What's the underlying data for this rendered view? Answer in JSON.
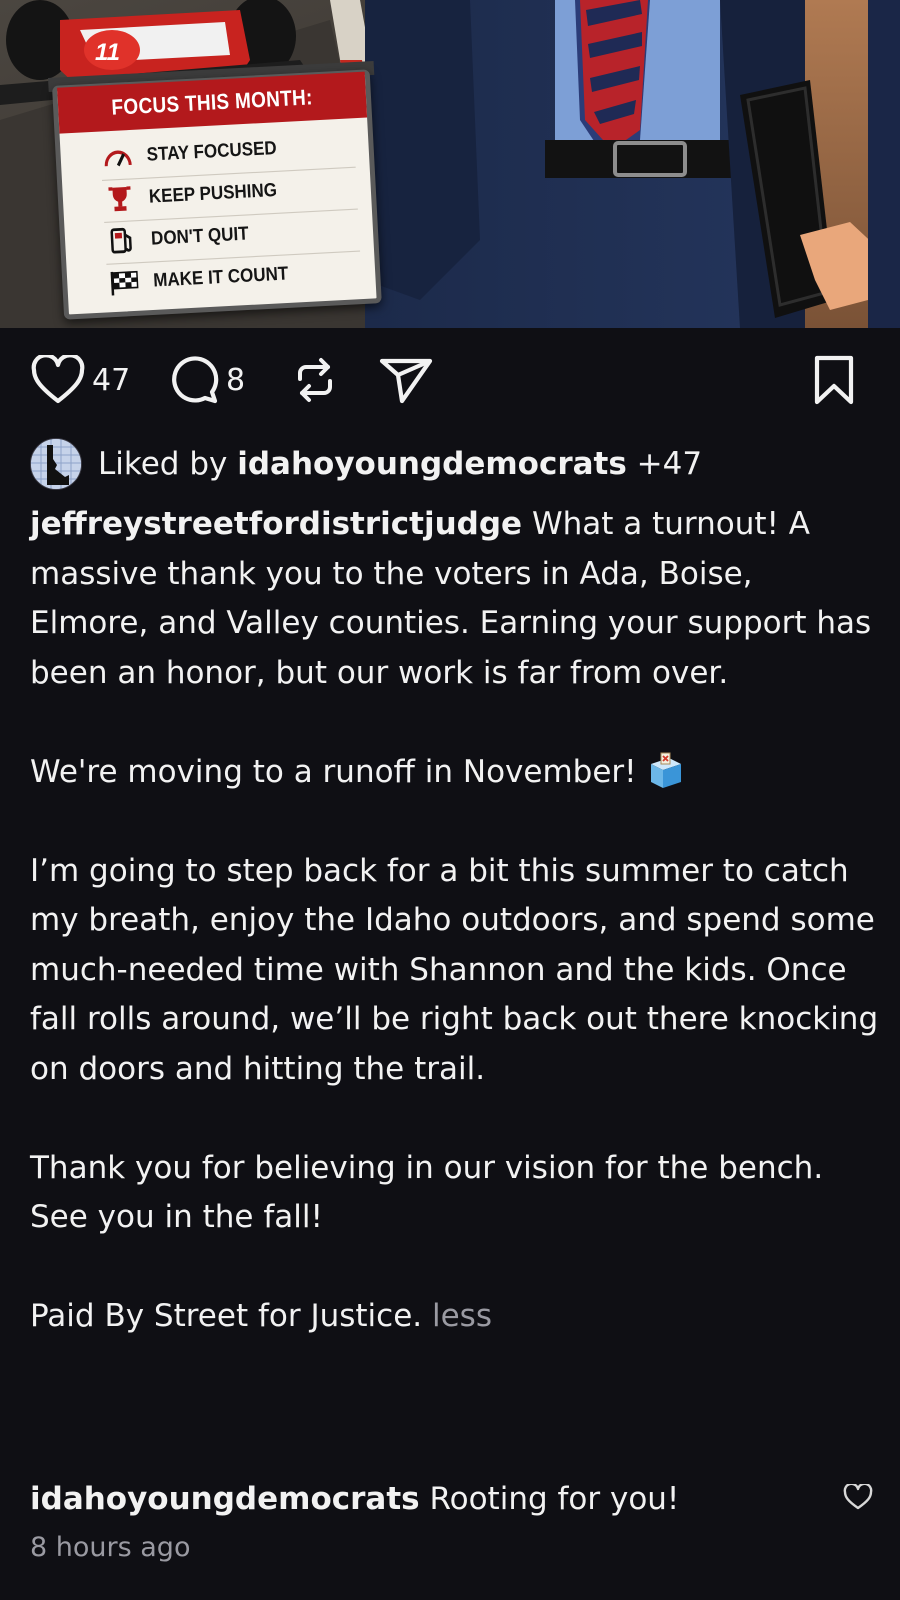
{
  "post_image": {
    "car_number": "11",
    "board": {
      "title": "FOCUS THIS MONTH:",
      "items": [
        {
          "icon": "speedometer-icon",
          "label": "STAY FOCUSED"
        },
        {
          "icon": "trophy-icon",
          "label": "KEEP PUSHING"
        },
        {
          "icon": "fuel-pump-icon",
          "label": "DON'T QUIT"
        },
        {
          "icon": "checkered-flag-icon",
          "label": "MAKE IT COUNT"
        }
      ]
    }
  },
  "actions": {
    "like_icon": "heart-icon",
    "like_count": "47",
    "comment_icon": "comment-icon",
    "comment_count": "8",
    "repost_icon": "repost-icon",
    "share_icon": "send-icon",
    "save_icon": "bookmark-icon"
  },
  "likes": {
    "prefix": "Liked by ",
    "user": "idahoyoungdemocrats",
    "suffix": " +47"
  },
  "caption": {
    "username": "jeffreystreetfordistrictjudge",
    "paragraphs": [
      "What a turnout! A massive thank you to the voters in Ada, Boise, Elmore, and Valley counties. Earning your support has been an honor, but our work is far from over.",
      "We're moving to a runoff in November!",
      "I’m going to step back for a bit this summer to catch my breath, enjoy the Idaho outdoors, and spend some much-needed time with Shannon and the kids. Once fall rolls around, we’ll be right back out there knocking on doors and hitting the trail.",
      "Thank you for believing in our vision for the bench. See you in the fall!",
      "Paid By Street for Justice."
    ],
    "emoji": "ballot-box-icon",
    "less_label": "less"
  },
  "comment": {
    "username": "idahoyoungdemocrats",
    "text": "Rooting for you!",
    "like_icon": "heart-icon"
  },
  "timestamp": "8 hours ago",
  "colors": {
    "background": "#0f0f14",
    "text": "#f2f2f2",
    "muted": "#9a9aa2",
    "board_red": "#b3191c"
  }
}
